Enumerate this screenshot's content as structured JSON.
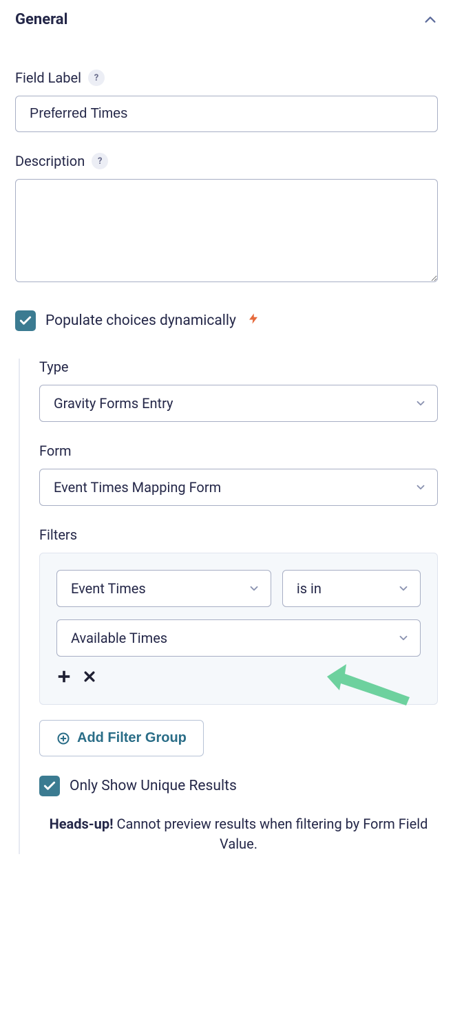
{
  "section": {
    "title": "General"
  },
  "fields": {
    "label": {
      "title": "Field Label",
      "value": "Preferred Times"
    },
    "description": {
      "title": "Description",
      "value": ""
    },
    "populate": {
      "label": "Populate choices dynamically",
      "checked": true
    }
  },
  "dynamic": {
    "type": {
      "label": "Type",
      "value": "Gravity Forms Entry"
    },
    "form": {
      "label": "Form",
      "value": "Event Times Mapping Form"
    },
    "filters": {
      "label": "Filters",
      "field": "Event Times",
      "operator": "is in",
      "value": "Available Times",
      "add_group": "Add Filter Group"
    },
    "unique": {
      "label": "Only Show Unique Results",
      "checked": true
    },
    "notice": {
      "prefix": "Heads-up!",
      "text": " Cannot preview results when filtering by Form Field Value."
    }
  }
}
